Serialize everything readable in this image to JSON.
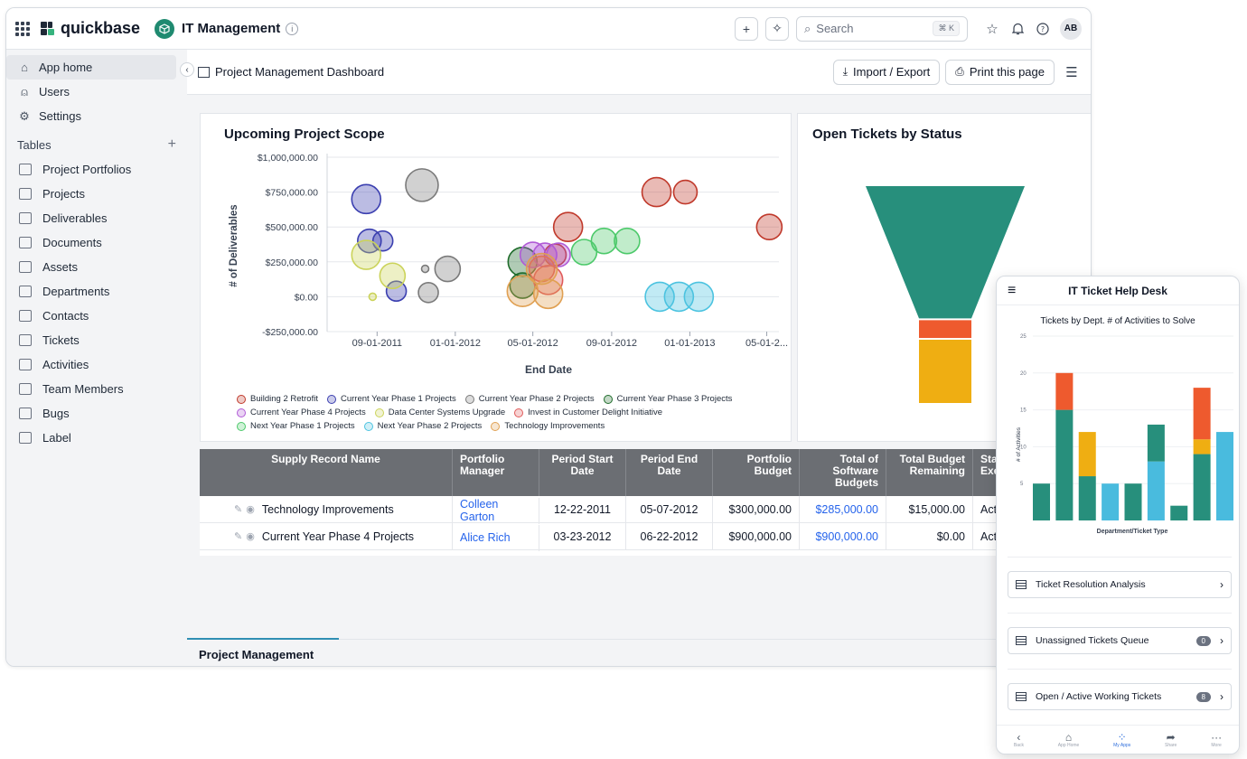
{
  "topbar": {
    "brand": "quickbase",
    "app_name": "IT Management",
    "search_placeholder": "Search",
    "search_shortcut": "⌘ K",
    "avatar_initials": "AB"
  },
  "sidebar": {
    "nav": [
      {
        "label": "App home",
        "icon": "home-icon"
      },
      {
        "label": "Users",
        "icon": "user-icon"
      },
      {
        "label": "Settings",
        "icon": "gear-icon"
      }
    ],
    "tables_heading": "Tables",
    "tables": [
      "Project Portfolios",
      "Projects",
      "Deliverables",
      "Documents",
      "Assets",
      "Departments",
      "Contacts",
      "Tickets",
      "Activities",
      "Team Members",
      "Bugs",
      "Label"
    ]
  },
  "header": {
    "title": "Project Management Dashboard",
    "import_export": "Import / Export",
    "print": "Print this page"
  },
  "scope_chart": {
    "title": "Upcoming Project Scope",
    "ylabel": "# of Deliverables",
    "xlabel": "End Date",
    "y_ticks": [
      "$1,000,000.00",
      "$750,000.00",
      "$500,000.00",
      "$250,000.00",
      "$0.00",
      "-$250,000.00"
    ],
    "x_ticks": [
      "09-01-2011",
      "01-01-2012",
      "05-01-2012",
      "09-01-2012",
      "01-01-2013",
      "05-01-2..."
    ]
  },
  "chart_data": [
    {
      "type": "scatter",
      "title": "Upcoming Project Scope",
      "xlabel": "End Date",
      "ylabel": "# of Deliverables",
      "ylim": [
        -250000,
        1000000
      ],
      "xlim": [
        "2011-06-15",
        "2013-05-20"
      ],
      "grid": true,
      "legend": "bottom",
      "series": [
        {
          "name": "Building 2 Retrofit",
          "color": "#c0392b",
          "points": [
            [
              "2012-11-10",
              750000,
              16
            ],
            [
              "2012-12-25",
              750000,
              13
            ],
            [
              "2012-06-25",
              500000,
              16
            ],
            [
              "2013-05-05",
              500000,
              14
            ],
            [
              "2012-06-05",
              300000,
              12
            ]
          ]
        },
        {
          "name": "Current Year Phase 1 Projects",
          "color": "#3b3fb0",
          "points": [
            [
              "2011-08-15",
              700000,
              16
            ],
            [
              "2011-08-20",
              400000,
              13
            ],
            [
              "2011-09-10",
              400000,
              11
            ],
            [
              "2011-10-01",
              40000,
              11
            ]
          ]
        },
        {
          "name": "Current Year Phase 2 Projects",
          "color": "#7a7a7a",
          "points": [
            [
              "2011-11-10",
              800000,
              18
            ],
            [
              "2011-12-20",
              200000,
              14
            ],
            [
              "2011-11-20",
              30000,
              11
            ],
            [
              "2011-11-15",
              200000,
              4
            ]
          ]
        },
        {
          "name": "Current Year Phase 3 Projects",
          "color": "#1e6b2a",
          "points": [
            [
              "2012-04-15",
              250000,
              16
            ],
            [
              "2012-04-15",
              80000,
              14
            ]
          ]
        },
        {
          "name": "Current Year Phase 4 Projects",
          "color": "#b05ad6",
          "points": [
            [
              "2012-05-01",
              300000,
              14
            ],
            [
              "2012-05-20",
              300000,
              13
            ],
            [
              "2012-06-10",
              300000,
              13
            ]
          ]
        },
        {
          "name": "Data Center Systems Upgrade",
          "color": "#cbd35a",
          "points": [
            [
              "2011-08-15",
              300000,
              16
            ],
            [
              "2011-09-25",
              150000,
              14
            ],
            [
              "2011-08-25",
              0,
              4
            ]
          ]
        },
        {
          "name": "Invest in Customer Delight Initiative",
          "color": "#e05a5a",
          "points": [
            [
              "2012-05-15",
              200000,
              14
            ],
            [
              "2012-05-25",
              120000,
              16
            ]
          ]
        },
        {
          "name": "Next Year Phase 1 Projects",
          "color": "#4cc96a",
          "points": [
            [
              "2012-07-20",
              320000,
              14
            ],
            [
              "2012-08-20",
              400000,
              14
            ],
            [
              "2012-09-25",
              400000,
              14
            ]
          ]
        },
        {
          "name": "Next Year Phase 2 Projects",
          "color": "#4cc3e0",
          "points": [
            [
              "2012-11-15",
              0,
              16
            ],
            [
              "2012-12-15",
              0,
              16
            ],
            [
              "2013-01-15",
              0,
              16
            ]
          ]
        },
        {
          "name": "Technology Improvements",
          "color": "#e0a052",
          "points": [
            [
              "2012-04-15",
              40000,
              17
            ],
            [
              "2012-05-15",
              200000,
              17
            ],
            [
              "2012-05-25",
              20000,
              16
            ]
          ]
        }
      ]
    },
    {
      "type": "funnel",
      "title": "Open Tickets by Status",
      "series": [
        {
          "color": "#278f7c",
          "value": 0.61
        },
        {
          "color": "#ee5a2e",
          "value": 0.09
        },
        {
          "color": "#efae12",
          "value": 0.3
        }
      ]
    },
    {
      "type": "bar",
      "title": "Tickets by Dept. # of Activities to Solve",
      "xlabel": "Department/Ticket Type",
      "ylabel": "# of Activities",
      "ylim": [
        0,
        25
      ],
      "y_ticks": [
        "25",
        "20",
        "15",
        "10",
        "5"
      ],
      "stacked": true,
      "bars": [
        [
          {
            "v": 5,
            "c": "#278f7c"
          }
        ],
        [
          {
            "v": 15,
            "c": "#278f7c"
          },
          {
            "v": 5,
            "c": "#ee5a2e"
          }
        ],
        [
          {
            "v": 6,
            "c": "#278f7c"
          },
          {
            "v": 6,
            "c": "#efae12"
          }
        ],
        [
          {
            "v": 5,
            "c": "#49bbde"
          }
        ],
        [
          {
            "v": 5,
            "c": "#278f7c"
          }
        ],
        [
          {
            "v": 8,
            "c": "#49bbde"
          },
          {
            "v": 5,
            "c": "#278f7c"
          }
        ],
        [
          {
            "v": 2,
            "c": "#278f7c"
          }
        ],
        [
          {
            "v": 9,
            "c": "#278f7c"
          },
          {
            "v": 2,
            "c": "#efae12"
          },
          {
            "v": 7,
            "c": "#ee5a2e"
          }
        ],
        [
          {
            "v": 12,
            "c": "#49bbde"
          }
        ]
      ]
    }
  ],
  "funnel": {
    "title": "Open Tickets by Status"
  },
  "table": {
    "columns": [
      "Supply Record Name",
      "Portfolio Manager",
      "Period Start Date",
      "Period End Date",
      "Portfolio Budget",
      "Total of Software Budgets",
      "Total Budget Remaining",
      "Stage Exec"
    ],
    "rows": [
      [
        "Technology Improvements",
        "Colleen Garton",
        "12-22-2011",
        "05-07-2012",
        "$300,000.00",
        "$285,000.00",
        "$15,000.00",
        "Acti"
      ],
      [
        "Current Year Phase 4 Projects",
        "Alice Rich",
        "03-23-2012",
        "06-22-2012",
        "$900,000.00",
        "$900,000.00",
        "$0.00",
        "Acti"
      ]
    ]
  },
  "bottom_tab": "Project Management",
  "phone": {
    "title": "IT Ticket Help Desk",
    "chart_title": "Tickets by Dept. # of Activities to Solve",
    "ylabel": "# of Activities",
    "xlabel": "Department/Ticket Type",
    "reports": [
      {
        "label": "Ticket Resolution Analysis",
        "badge": ""
      },
      {
        "label": "Unassigned Tickets Queue",
        "badge": "0"
      },
      {
        "label": "Open / Active Working Tickets",
        "badge": "8"
      }
    ],
    "footer": [
      "Back",
      "App Home",
      "My Apps",
      "Share",
      "More"
    ]
  },
  "colors": {
    "accent": "#1f8a70",
    "link": "#2563eb",
    "header_gray": "#6b6e73"
  }
}
